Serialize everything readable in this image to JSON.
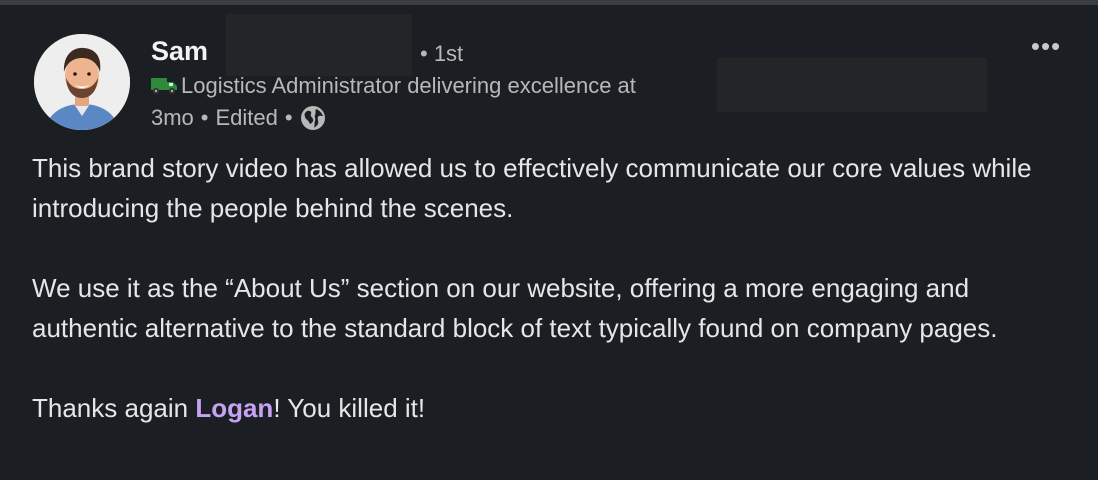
{
  "post": {
    "author": {
      "name": "Sam",
      "degree": "• 1st",
      "headline": "Logistics Administrator delivering excellence at",
      "headline_icon": "delivery-truck-emoji"
    },
    "meta": {
      "age": "3mo",
      "sep1": "•",
      "edited": "Edited",
      "sep2": "•",
      "visibility_icon": "globe-icon"
    },
    "menu_icon": "•••",
    "body": {
      "p1": "This brand story video has allowed us to effectively communicate our core values while introducing the people behind the scenes.",
      "p2": "We use it as the “About Us” section on our website, offering a more engaging and authentic alternative to the standard block of text typically found on company pages.",
      "p3_before": "Thanks again ",
      "p3_mention": "Logan",
      "p3_after": "! You killed it!"
    },
    "colors": {
      "background": "#1b1f23",
      "mention": "#c6a2f2",
      "secondary_text": "#b8b8b8"
    }
  }
}
